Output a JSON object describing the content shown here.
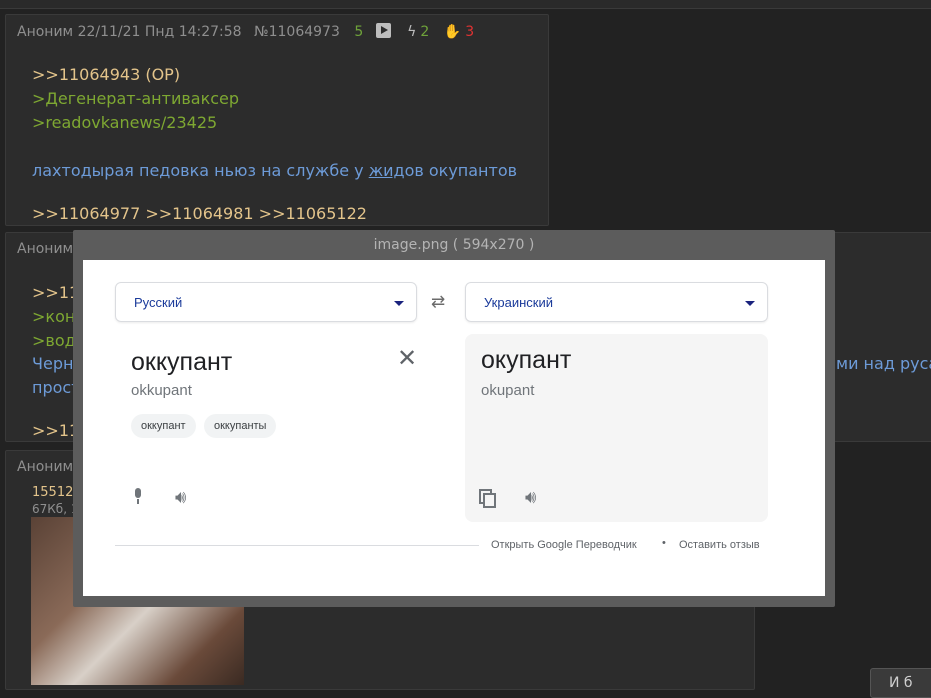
{
  "post1": {
    "author": "Аноним",
    "datetime": "22/11/21 Пнд 14:27:58",
    "number": "№11064973",
    "likes": "5",
    "positive": "2",
    "negative": "3",
    "reply_to": ">>11064943 (OP)",
    "quote1": ">Дегенерат-антиваксер",
    "quote2": ">readovkanews/23425",
    "text_before": "лахтодырая педовка ньюз на службе у ",
    "text_underlined": "жид",
    "text_after": "ов окупантов",
    "replies": ">>11064977 >>11065122",
    "replies_full": ">>11064977 >>11064981 >>11065122"
  },
  "post2": {
    "author": "Аноним",
    "line1": ">>110",
    "line2": ">кон",
    "line3": ">вод",
    "line4": "Черн",
    "line4_right": "ми над руса",
    "line5": "прост",
    "replies": ">>1106"
  },
  "post3": {
    "author": "Аноним",
    "file_name": "155129",
    "file_meta": "67Кб, 1"
  },
  "modal": {
    "title": "image.png ( 594x270 )",
    "source_lang": "Русский",
    "target_lang": "Украинский",
    "source_word": "оккупант",
    "source_translit": "okkupant",
    "chips": [
      "оккупант",
      "оккупанты"
    ],
    "target_word": "окупант",
    "target_translit": "okupant",
    "open_link": "Открыть Google Переводчик",
    "dot": "•",
    "feedback_link": "Оставить отзыв"
  },
  "bottom_button": "И б"
}
